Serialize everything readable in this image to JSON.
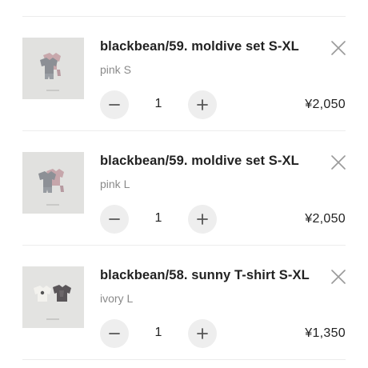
{
  "cart": {
    "items": [
      {
        "name": "blackbean/59. moldive set S-XL",
        "variant": "pink S",
        "quantity": "1",
        "price": "¥2,050",
        "image_icon": "product-photo-grey-and-pink-set"
      },
      {
        "name": "blackbean/59. moldive set S-XL",
        "variant": "pink L",
        "quantity": "1",
        "price": "¥2,050",
        "image_icon": "product-photo-grey-and-pink-set"
      },
      {
        "name": "blackbean/58. sunny T-shirt S-XL",
        "variant": "ivory L",
        "quantity": "1",
        "price": "¥1,350",
        "image_icon": "product-photo-ivory-and-charcoal-tees"
      }
    ],
    "icons": {
      "remove": "close-icon",
      "decrease": "minus-icon",
      "increase": "plus-icon"
    },
    "colors": {
      "qty_button_bg": "#eeeeee",
      "variant_text": "#8a8a8a",
      "divider": "#ececec"
    }
  }
}
